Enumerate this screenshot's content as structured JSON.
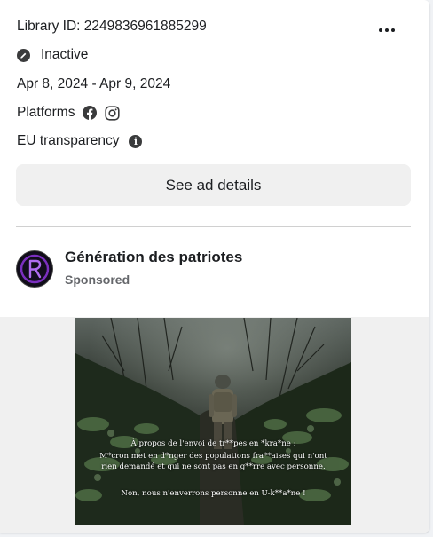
{
  "ad": {
    "library_id": "Library ID: 2249836961885299",
    "status": "Inactive",
    "date_range": "Apr 8, 2024 - Apr 9, 2024",
    "platforms_label": "Platforms",
    "platforms": [
      "facebook-icon",
      "instagram-icon"
    ],
    "eu_label": "EU transparency",
    "details_button": "See ad details"
  },
  "advertiser": {
    "name": "Génération des patriotes",
    "sponsored_label": "Sponsored"
  },
  "creative": {
    "line1": "À propos de l'envoi de tr**pes en *kra*ne :",
    "line2": "M*cron met en d*nger des populations fra**aises qui n'ont",
    "line3": "rien demandé et qui ne sont pas en g**rre avec personne.",
    "line4": "Non, nous n'enverrons personne en U-k**a*ne !"
  },
  "colors": {
    "icon_dark": "#3a3b3c",
    "button_bg": "#f0f0f0",
    "secondary_text": "#65676b",
    "avatar_accent": "#7b2fbf"
  }
}
